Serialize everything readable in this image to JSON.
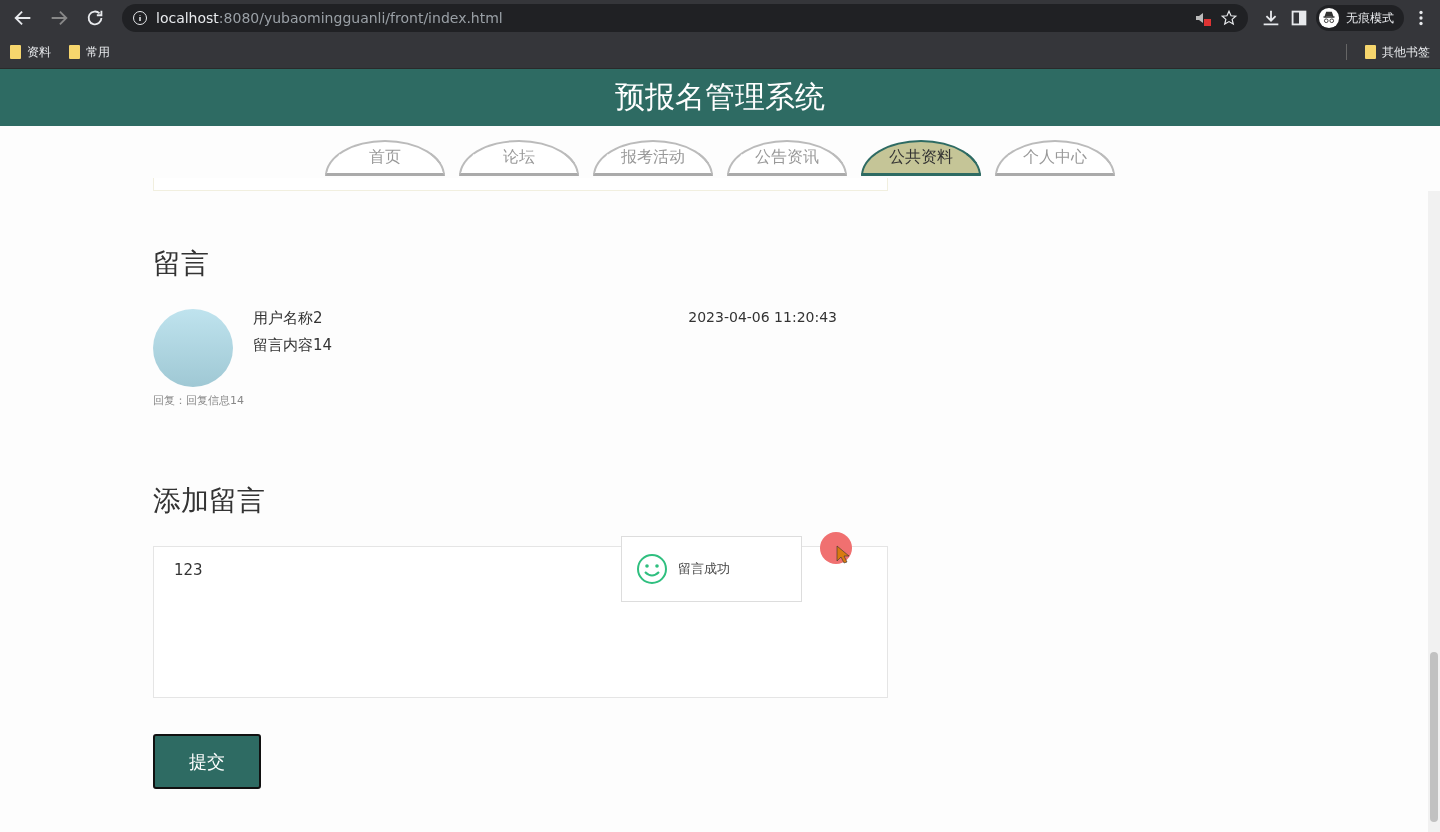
{
  "browser": {
    "url_host": "localhost",
    "url_rest": ":8080/yubaomingguanli/front/index.html",
    "profile": "无痕模式",
    "bookmarks": [
      "资料",
      "常用"
    ],
    "other_bookmarks": "其他书签"
  },
  "site_title": "预报名管理系统",
  "nav_tabs": [
    {
      "label": "首页",
      "selected": false
    },
    {
      "label": "论坛",
      "selected": false
    },
    {
      "label": "报考活动",
      "selected": false
    },
    {
      "label": "公告资讯",
      "selected": false
    },
    {
      "label": "公共资料",
      "selected": true
    },
    {
      "label": "个人中心",
      "selected": false
    }
  ],
  "messages_heading": "留言",
  "messages": [
    {
      "user": "用户名称2",
      "content": "留言内容14",
      "time": "2023-04-06 11:20:43",
      "reply": "回复：回复信息14"
    }
  ],
  "add_heading": "添加留言",
  "message_input": {
    "value": "123"
  },
  "submit_button": "提交",
  "toast": {
    "text": "留言成功"
  }
}
